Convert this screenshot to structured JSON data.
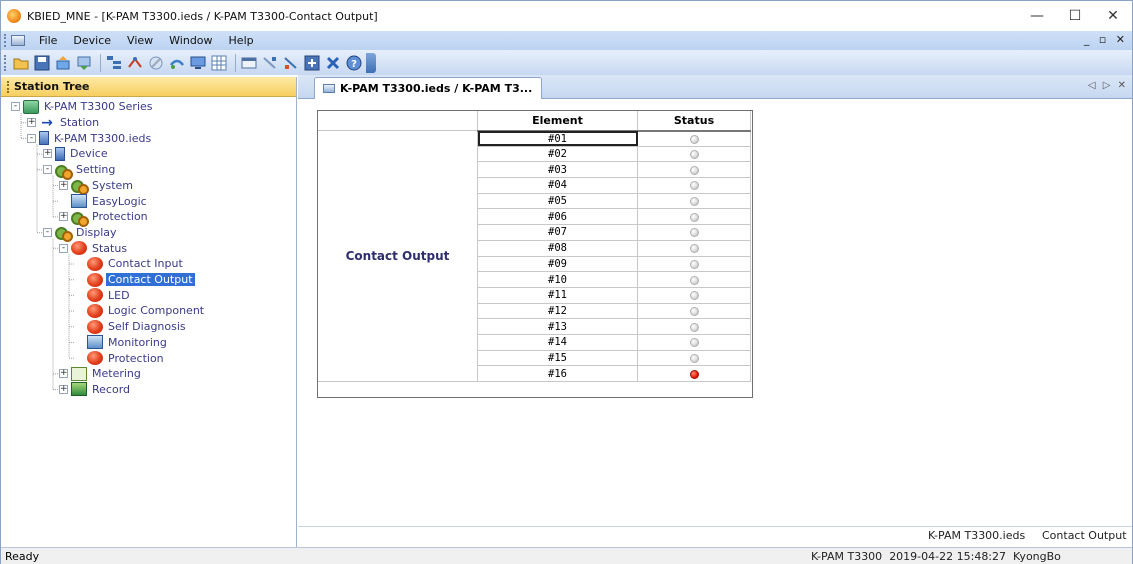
{
  "window": {
    "title": "KBIED_MNE - [K-PAM T3300.ieds / K-PAM T3300-Contact Output]",
    "buttons": [
      "—",
      "☐",
      "✕"
    ]
  },
  "menu": {
    "items": [
      "File",
      "Device",
      "View",
      "Window",
      "Help"
    ],
    "mdi_buttons": "_ ▫ ✕"
  },
  "toolbar": {
    "icons": [
      "open-icon",
      "save-icon",
      "upload-icon",
      "download-icon",
      "tree-icon",
      "connect-icon",
      "disconnect-icon",
      "settings-icon",
      "monitor-icon",
      "grid-icon",
      "window-icon",
      "import-icon",
      "export-icon",
      "add-icon",
      "delete-icon",
      "help-icon"
    ]
  },
  "station_tree": {
    "header": "Station Tree",
    "items": [
      {
        "label": "K-PAM T3300 Series",
        "level": 0,
        "icon": "root"
      },
      {
        "label": "Station",
        "level": 1,
        "icon": "arrow"
      },
      {
        "label": "K-PAM T3300.ieds",
        "level": 1,
        "icon": "ieds"
      },
      {
        "label": "Device",
        "level": 2,
        "icon": "device"
      },
      {
        "label": "Setting",
        "level": 2,
        "icon": "gears"
      },
      {
        "label": "System",
        "level": 3,
        "icon": "gears"
      },
      {
        "label": "EasyLogic",
        "level": 3,
        "icon": "monitor"
      },
      {
        "label": "Protection",
        "level": 3,
        "icon": "gears"
      },
      {
        "label": "Display",
        "level": 2,
        "icon": "gears"
      },
      {
        "label": "Status",
        "level": 3,
        "icon": "red"
      },
      {
        "label": "Contact Input",
        "level": 4,
        "icon": "red"
      },
      {
        "label": "Contact Output",
        "level": 4,
        "icon": "red",
        "selected": true
      },
      {
        "label": "LED",
        "level": 4,
        "icon": "red"
      },
      {
        "label": "Logic Component",
        "level": 4,
        "icon": "red"
      },
      {
        "label": "Self Diagnosis",
        "level": 4,
        "icon": "red"
      },
      {
        "label": "Monitoring",
        "level": 4,
        "icon": "monitor"
      },
      {
        "label": "Protection",
        "level": 4,
        "icon": "red"
      },
      {
        "label": "Metering",
        "level": 3,
        "icon": "table"
      },
      {
        "label": "Record",
        "level": 3,
        "icon": "record"
      }
    ]
  },
  "document": {
    "tab_label": "K-PAM T3300.ieds / K-PAM T3...",
    "nav": "◁ ▷ ✕",
    "table": {
      "headers": [
        "Element",
        "Status"
      ],
      "group": "Contact Output",
      "rows": [
        {
          "element": "#01",
          "status": "off"
        },
        {
          "element": "#02",
          "status": "off"
        },
        {
          "element": "#03",
          "status": "off"
        },
        {
          "element": "#04",
          "status": "off"
        },
        {
          "element": "#05",
          "status": "off"
        },
        {
          "element": "#06",
          "status": "off"
        },
        {
          "element": "#07",
          "status": "off"
        },
        {
          "element": "#08",
          "status": "off"
        },
        {
          "element": "#09",
          "status": "off"
        },
        {
          "element": "#10",
          "status": "off"
        },
        {
          "element": "#11",
          "status": "off"
        },
        {
          "element": "#12",
          "status": "off"
        },
        {
          "element": "#13",
          "status": "off"
        },
        {
          "element": "#14",
          "status": "off"
        },
        {
          "element": "#15",
          "status": "off"
        },
        {
          "element": "#16",
          "status": "on"
        }
      ]
    },
    "footer": {
      "file": "K-PAM T3300.ieds",
      "view": "Contact Output"
    }
  },
  "statusbar": {
    "left": "Ready",
    "device": "K-PAM T3300",
    "datetime": "2019-04-22 15:48:27",
    "user": "KyongBo"
  },
  "colors": {
    "led_on": "#e81e08",
    "led_off": "#d9d9d9",
    "selection": "#2f6fd6",
    "tree_header": "#f7cf5f"
  }
}
